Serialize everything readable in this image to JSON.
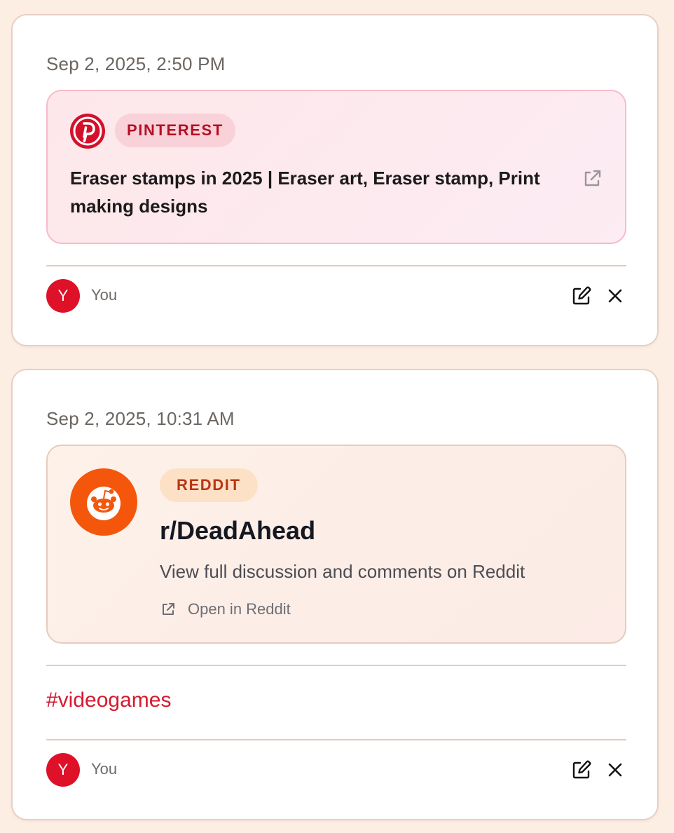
{
  "posts": [
    {
      "timestamp": "Sep 2, 2025, 2:50 PM",
      "embed": {
        "platform_badge": "PINTEREST",
        "title": "Eraser stamps in 2025 | Eraser art, Eraser stamp, Print making designs",
        "icon": "pinterest-logo-icon",
        "accent_color": "#d40f2a"
      },
      "author": {
        "avatar_initial": "Y",
        "name": "You"
      }
    },
    {
      "timestamp": "Sep 2, 2025, 10:31 AM",
      "embed": {
        "platform_badge": "REDDIT",
        "title": "r/DeadAhead",
        "description": "View full discussion and comments on Reddit",
        "open_link_label": "Open in Reddit",
        "icon": "reddit-logo-icon",
        "accent_color": "#f4570c"
      },
      "hashtag": "#videogames",
      "author": {
        "avatar_initial": "Y",
        "name": "You"
      }
    }
  ],
  "colors": {
    "page_background": "#fdeee4",
    "avatar": "#de1129",
    "hashtag": "#d31a2f"
  }
}
